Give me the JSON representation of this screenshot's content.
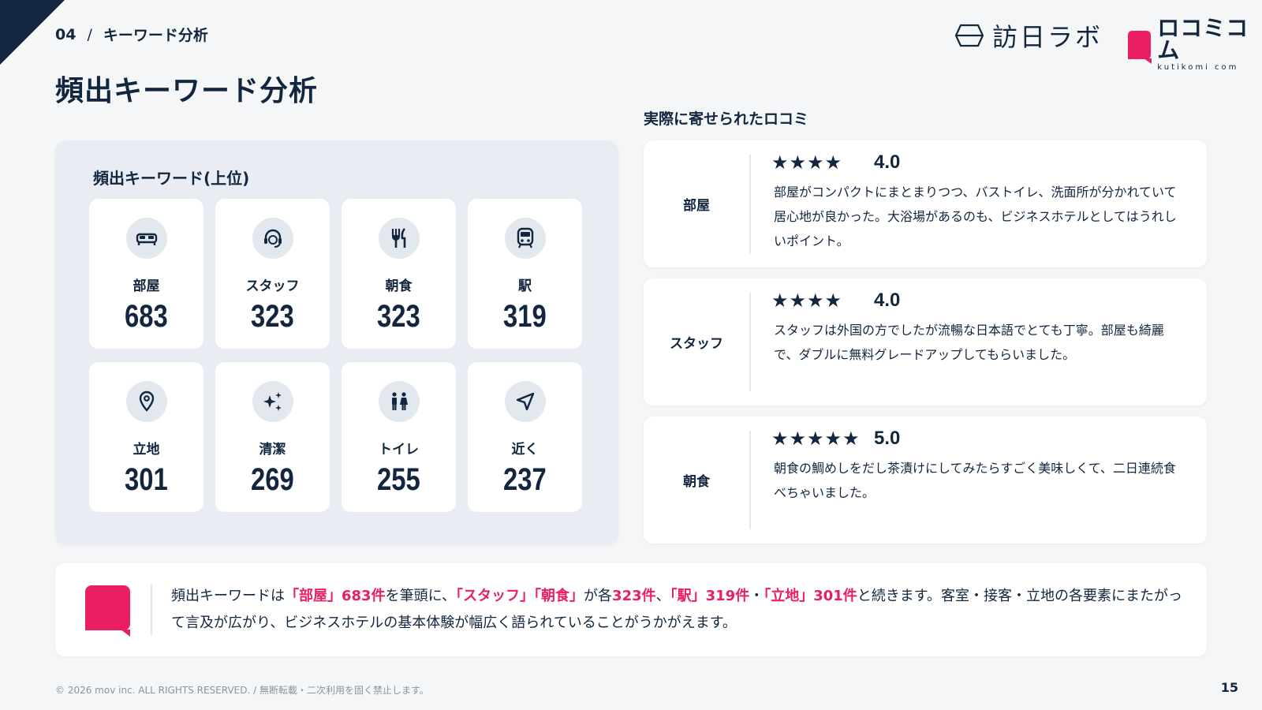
{
  "header": {
    "section_number": "04",
    "separator": "/",
    "section_title": "キーワード分析",
    "page_title": "頻出キーワード分析"
  },
  "logos": {
    "hounichi_text": "訪日ラボ",
    "kutikomi_jp": "ロコミコム",
    "kutikomi_en": "kutikomi com"
  },
  "keywords": {
    "title": "頻出キーワード(上位)",
    "items": [
      {
        "label": "部屋",
        "count": "683",
        "icon": "bed-icon"
      },
      {
        "label": "スタッフ",
        "count": "323",
        "icon": "support-agent-icon"
      },
      {
        "label": "朝食",
        "count": "323",
        "icon": "fork-knife-icon"
      },
      {
        "label": "駅",
        "count": "319",
        "icon": "train-icon"
      },
      {
        "label": "立地",
        "count": "301",
        "icon": "location-pin-icon"
      },
      {
        "label": "清潔",
        "count": "269",
        "icon": "sparkle-icon"
      },
      {
        "label": "トイレ",
        "count": "255",
        "icon": "restroom-icon"
      },
      {
        "label": "近く",
        "count": "237",
        "icon": "navigation-arrow-icon"
      }
    ]
  },
  "reviews": {
    "title": "実際に寄せられたロコミ",
    "items": [
      {
        "category": "部屋",
        "stars": "★★★★",
        "rating": "4.0",
        "stars_value": 4,
        "text": "部屋がコンパクトにまとまりつつ、バストイレ、洗面所が分かれていて居心地が良かった。大浴場があるのも、ビジネスホテルとしてはうれしいポイント。"
      },
      {
        "category": "スタッフ",
        "stars": "★★★★",
        "rating": "4.0",
        "stars_value": 4,
        "text": "スタッフは外国の方でしたが流暢な日本語でとても丁寧。部屋も綺麗で、ダブルに無料グレードアップしてもらいました。"
      },
      {
        "category": "朝食",
        "stars": "★★★★★",
        "rating": "5.0",
        "stars_value": 5,
        "text": "朝食の鯛めしをだし茶漬けにしてみたらすごく美味しくて、二日連続食べちゃいました。"
      }
    ]
  },
  "summary": {
    "parts": [
      {
        "text": "頻出キーワードは",
        "hl": false
      },
      {
        "text": "「部屋」683件",
        "hl": true
      },
      {
        "text": "を筆頭に、",
        "hl": false
      },
      {
        "text": "「スタッフ」「朝食」",
        "hl": true
      },
      {
        "text": "が各",
        "hl": false
      },
      {
        "text": "323件",
        "hl": true
      },
      {
        "text": "、",
        "hl": false
      },
      {
        "text": "「駅」319件",
        "hl": true
      },
      {
        "text": "・",
        "hl": false
      },
      {
        "text": "「立地」301件",
        "hl": true
      },
      {
        "text": "と続きます。客室・接客・立地の各要素にまたがって言及が広がり、ビジネスホテルの基本体験が幅広く語られていることがうかがえます。",
        "hl": false
      }
    ]
  },
  "footer": {
    "copyright": "© 2026 mov inc. ALL RIGHTS RESERVED. / 無断転載・二次利用を固く禁止します。",
    "page_number": "15"
  },
  "colors": {
    "navy": "#12263f",
    "accent_pink": "#e91e63",
    "panel_bg": "#e9edf3",
    "icon_bg": "#e3e8ef"
  }
}
